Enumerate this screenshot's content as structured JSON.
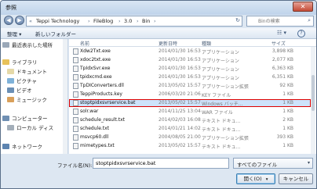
{
  "window": {
    "title": "参照",
    "close_glyph": "✕"
  },
  "address": {
    "back_glyph": "◀",
    "forward_glyph": "▶",
    "prefix": "«",
    "crumbs": [
      "Teppi Technology",
      "FileBlog",
      "3.0",
      "Bin"
    ],
    "refresh_glyph": "↻"
  },
  "search": {
    "placeholder": "Binの検索",
    "icon": "search-icon",
    "glyph": "⌕"
  },
  "toolbar": {
    "organize": "整理 ▾",
    "new_folder": "新しいフォルダー",
    "view_glyph": "☷ ▾",
    "help_glyph": "?"
  },
  "nav": {
    "items": [
      {
        "label": "最近表示した場所",
        "icon": "recent-places-icon",
        "color": "#9aa8b8"
      },
      {
        "label": "ライブラリ",
        "icon": "library-icon",
        "color": "#e8c25a"
      },
      {
        "label": "ドキュメント",
        "icon": "documents-icon",
        "color": "#e5d9a8"
      },
      {
        "label": "ピクチャ",
        "icon": "pictures-icon",
        "color": "#7fb2d9"
      },
      {
        "label": "ビデオ",
        "icon": "videos-icon",
        "color": "#6a8fb5"
      },
      {
        "label": "ミュージック",
        "icon": "music-icon",
        "color": "#d9a05a"
      },
      {
        "label": "コンピューター",
        "icon": "computer-icon",
        "color": "#6f8fb3"
      },
      {
        "label": "ローカル ディス",
        "icon": "local-disk-icon",
        "color": "#a3aeb9"
      },
      {
        "label": "ネットワーク",
        "icon": "network-icon",
        "color": "#5d84b0"
      }
    ]
  },
  "columns": {
    "name": "名前",
    "date": "更新日時",
    "type": "種類",
    "size": "サイズ"
  },
  "files": [
    {
      "name": "Xdw2Txt.exe",
      "date": "2014/01/30 16:53",
      "type": "アプリケーション",
      "size": "3,898 KB"
    },
    {
      "name": "xdoc2txt.exe",
      "date": "2014/01/30 16:53",
      "type": "アプリケーション",
      "size": "2,077 KB"
    },
    {
      "name": "TpIdxSvr.exe",
      "date": "2014/01/30 16:53",
      "type": "アプリケーション",
      "size": "6,363 KB"
    },
    {
      "name": "tpidxcmd.exe",
      "date": "2014/01/30 16:53",
      "type": "アプリケーション",
      "size": "6,351 KB"
    },
    {
      "name": "TpDIConverters.dll",
      "date": "2013/05/02 15:57",
      "type": "アプリケーション拡張",
      "size": "92 KB"
    },
    {
      "name": "TeppiProducts.key",
      "date": "2006/03/20 21:06",
      "type": "KEY ファイル",
      "size": "1 KB"
    },
    {
      "name": "stoptpidxsvrservice.bat",
      "date": "2013/05/02 15:57",
      "type": "Windows バッチ...",
      "size": "1 KB",
      "selected": true
    },
    {
      "name": "solr.war",
      "date": "2014/11/25 13:04",
      "type": "WAR ファイル",
      "size": "1 KB"
    },
    {
      "name": "schedule_result.txt",
      "date": "2014/02/03 16:08",
      "type": "テキスト ドキュ...",
      "size": "2 KB"
    },
    {
      "name": "schedule.txt",
      "date": "2014/01/21 14:02",
      "type": "テキスト ドキュ...",
      "size": "1 KB"
    },
    {
      "name": "msvcp60.dll",
      "date": "2004/08/05 21:00",
      "type": "アプリケーション拡張",
      "size": "393 KB"
    },
    {
      "name": "mimetypes.txt",
      "date": "2013/05/02 15:57",
      "type": "テキスト ドキュ...",
      "size": "1 KB"
    }
  ],
  "footer": {
    "filename_label": "ファイル名(N):",
    "filename_value": "stoptpidxsvrservice.bat",
    "filetype_value": "すべてのファイル",
    "filetype_chevron": "▾",
    "open_label": "開く(O)",
    "open_chevron": "▾",
    "cancel_label": "キャンセル"
  }
}
